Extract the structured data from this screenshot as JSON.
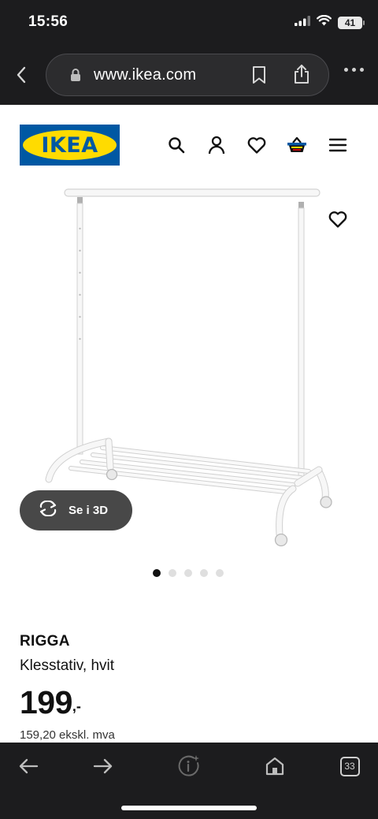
{
  "status_bar": {
    "time": "15:56",
    "battery": "41",
    "icons": [
      "signal-icon",
      "wifi-icon",
      "battery-icon"
    ]
  },
  "browser": {
    "url": "www.ikea.com",
    "icons": [
      "back-chevron-icon",
      "lock-icon",
      "bookmark-icon",
      "share-icon",
      "more-icon"
    ]
  },
  "header": {
    "logo_text": "IKEA",
    "icons": [
      "search-icon",
      "user-icon",
      "heart-icon",
      "basket-icon",
      "menu-icon"
    ],
    "colors": {
      "logo_blue": "#0058a3",
      "logo_yellow": "#ffdb00"
    }
  },
  "product": {
    "view_3d_label": "Se i 3D",
    "carousel": {
      "total": 5,
      "active": 1
    },
    "name": "RIGGA",
    "description": "Klesstativ, hvit",
    "price": "199",
    "price_suffix": ",-",
    "price_ex_vat": "159,20 ekskl. mva"
  },
  "toolbar": {
    "tabs_count": "33",
    "icons": [
      "back-arrow-icon",
      "forward-arrow-icon",
      "info-sparkle-icon",
      "home-icon",
      "tabs-icon"
    ]
  }
}
